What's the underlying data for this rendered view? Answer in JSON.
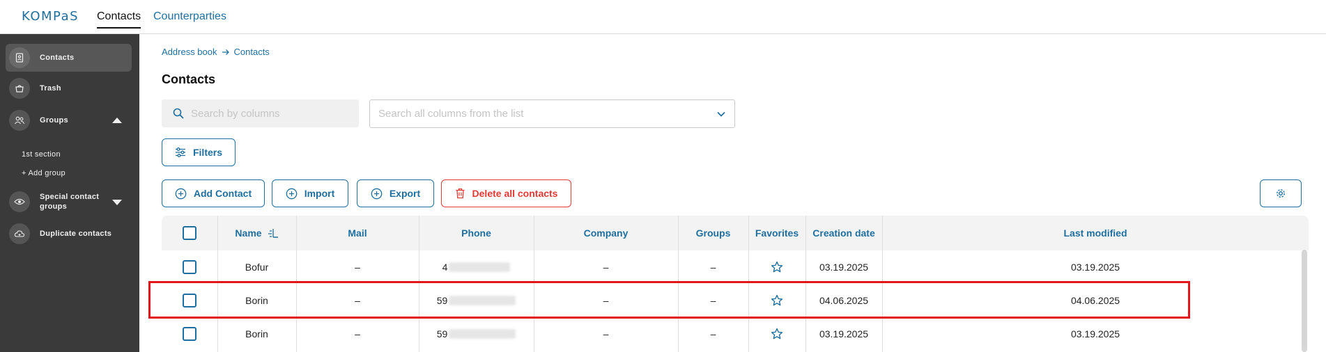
{
  "app": {
    "logo": "KOMPaS"
  },
  "topnav": {
    "contacts": "Contacts",
    "counterparties": "Counterparties"
  },
  "sidebar": {
    "contacts": "Contacts",
    "trash": "Trash",
    "groups": "Groups",
    "first_section": "1st section",
    "add_group": "+ Add group",
    "special_line1": "Special contact",
    "special_line2": "groups",
    "duplicates": "Duplicate contacts"
  },
  "breadcrumb": {
    "root": "Address book",
    "current": "Contacts"
  },
  "page": {
    "title": "Contacts"
  },
  "search": {
    "placeholder": "Search by columns"
  },
  "column_select": {
    "placeholder": "Search all columns from the list"
  },
  "toolbar": {
    "filters": "Filters",
    "add_contact": "Add Contact",
    "import": "Import",
    "export": "Export",
    "delete_all": "Delete all contacts"
  },
  "table": {
    "headers": {
      "name": "Name",
      "mail": "Mail",
      "phone": "Phone",
      "company": "Company",
      "groups": "Groups",
      "favorites": "Favorites",
      "creation_date": "Creation date",
      "last_modified": "Last modified"
    },
    "rows": [
      {
        "name": "Bofur",
        "mail": "–",
        "phone": "4",
        "company": "–",
        "groups": "–",
        "created": "03.19.2025",
        "modified": "03.19.2025"
      },
      {
        "name": "Borin",
        "mail": "–",
        "phone": "59",
        "company": "–",
        "groups": "–",
        "created": "04.06.2025",
        "modified": "04.06.2025"
      },
      {
        "name": "Borin",
        "mail": "–",
        "phone": "59",
        "company": "–",
        "groups": "–",
        "created": "03.19.2025",
        "modified": "03.19.2025"
      }
    ]
  },
  "colors": {
    "accent": "#1f6f9e",
    "danger": "#e53935",
    "highlight": "#e4141b",
    "sidebar": "#3a3a3a"
  }
}
